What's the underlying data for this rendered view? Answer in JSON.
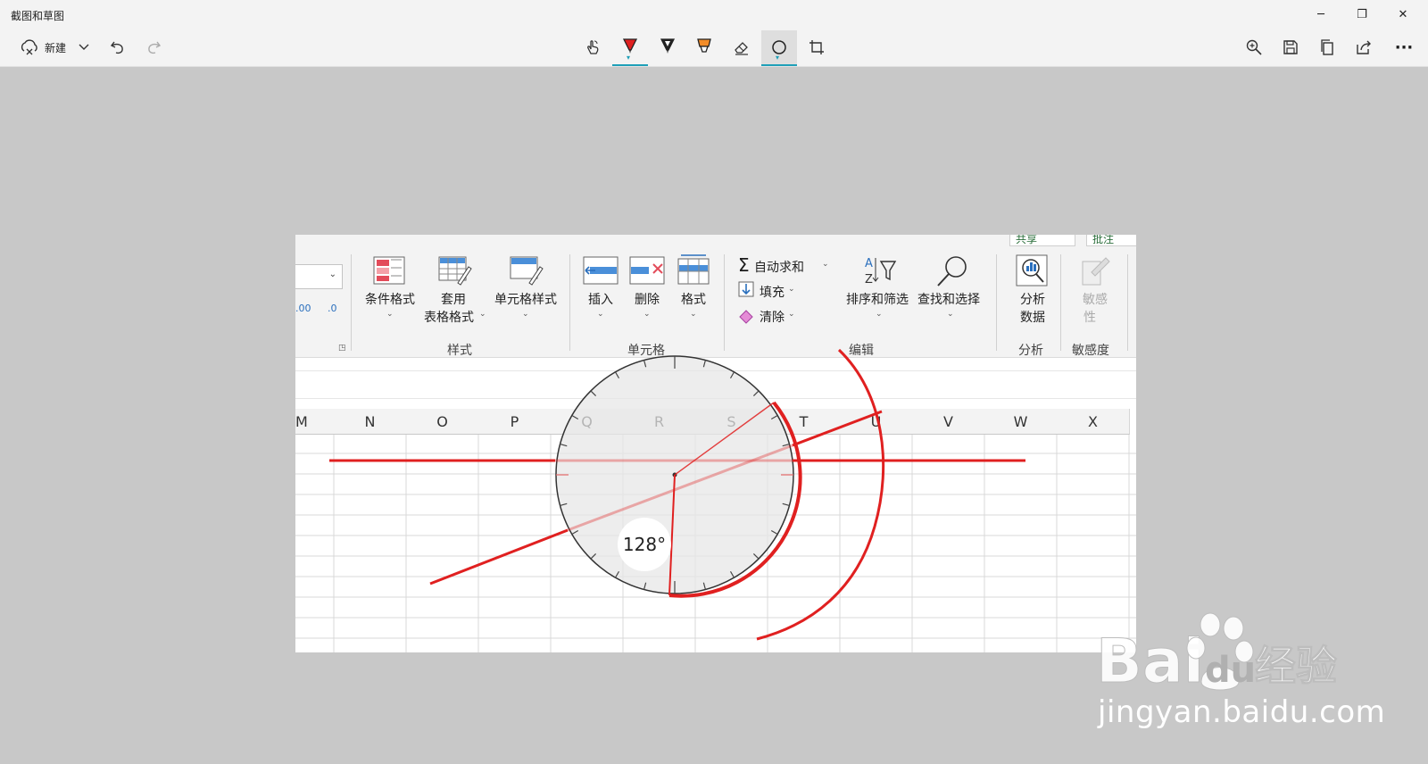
{
  "app": {
    "title": "截图和草图"
  },
  "window": {
    "minimize": "─",
    "restore": "❐",
    "close": "✕"
  },
  "toolbar": {
    "new_label": "新建",
    "more_label": "···",
    "accent_color": "#1fa0b8"
  },
  "ribbon": {
    "buttons": {
      "conditional_format": "条件格式",
      "table_format_1": "套用",
      "table_format_2": "表格格式",
      "cell_style": "单元格样式",
      "insert": "插入",
      "delete": "删除",
      "format": "格式",
      "autosum": "自动求和",
      "fill": "填充",
      "clear": "清除",
      "sort_filter": "排序和筛选",
      "find_select": "查找和选择",
      "analyze_1": "分析",
      "analyze_2": "数据",
      "sensitivity_1": "敏感",
      "sensitivity_2": "性",
      "dec_inc": ".00",
      "dec_dec": ".0"
    },
    "groups": {
      "styles": "样式",
      "cells": "单元格",
      "editing": "编辑",
      "analysis": "分析",
      "sensitivity": "敏感度"
    },
    "top_buttons": {
      "share": "共享",
      "comments": "批注"
    }
  },
  "sheet": {
    "columns": [
      "M",
      "N",
      "O",
      "P",
      "Q",
      "R",
      "S",
      "T",
      "U",
      "V",
      "W",
      "X"
    ]
  },
  "protractor": {
    "angle_label": "128°"
  },
  "ink_color": "#e02020",
  "watermark": {
    "brand": "Bai",
    "brand2": "经验",
    "url": "jingyan.baidu.com"
  }
}
